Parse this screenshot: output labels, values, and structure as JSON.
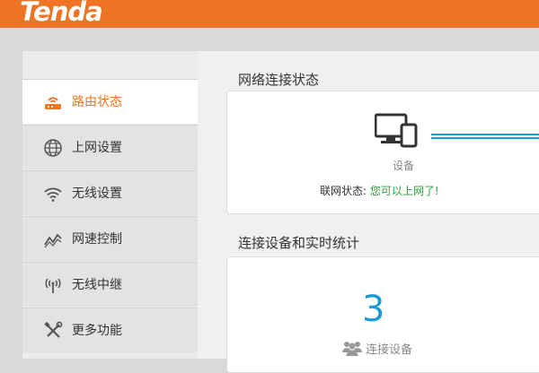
{
  "header": {
    "brand": "Tenda"
  },
  "sidebar": {
    "items": [
      {
        "label": "路由状态",
        "icon": "router-icon",
        "active": true
      },
      {
        "label": "上网设置",
        "icon": "globe-icon"
      },
      {
        "label": "无线设置",
        "icon": "wifi-icon"
      },
      {
        "label": "网速控制",
        "icon": "speed-chart-icon"
      },
      {
        "label": "无线中继",
        "icon": "antenna-icon"
      },
      {
        "label": "更多功能",
        "icon": "tools-icon"
      }
    ]
  },
  "main": {
    "connection": {
      "title": "网络连接状态",
      "device_label": "设备",
      "status_label": "联网状态: ",
      "status_value": "您可以上网了!"
    },
    "stats": {
      "title": "连接设备和实时统计",
      "device_count": "3",
      "device_count_label": "连接设备"
    }
  },
  "colors": {
    "brand": "#ee7322",
    "accent": "#1a9ad6",
    "success": "#2ea03a"
  }
}
